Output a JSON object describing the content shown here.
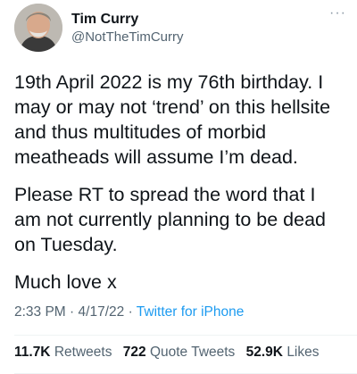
{
  "author": {
    "display_name": "Tim Curry",
    "handle": "@NotTheTimCurry",
    "avatar_icon": "person-avatar-icon"
  },
  "more_icon": "ellipsis-icon",
  "tweet": {
    "paragraphs": [
      "19th April 2022 is my 76th birthday. I\nmay or may not ‘trend’ on this hellsite\nand thus multitudes of morbid\nmeatheads will assume I’m dead.",
      "Please RT to spread the word that I\nam not currently planning to be dead\non Tuesday.",
      "Much love x"
    ]
  },
  "meta": {
    "time": "2:33 PM",
    "date": "4/17/22",
    "separator": "·",
    "source": "Twitter for iPhone"
  },
  "stats": {
    "retweets_count": "11.7K",
    "retweets_label": "Retweets",
    "quotes_count": "722",
    "quotes_label": "Quote Tweets",
    "likes_count": "52.9K",
    "likes_label": "Likes"
  },
  "colors": {
    "text": "#0f1419",
    "secondary": "#536471",
    "link": "#1d9bf0",
    "divider": "#eff3f4"
  }
}
